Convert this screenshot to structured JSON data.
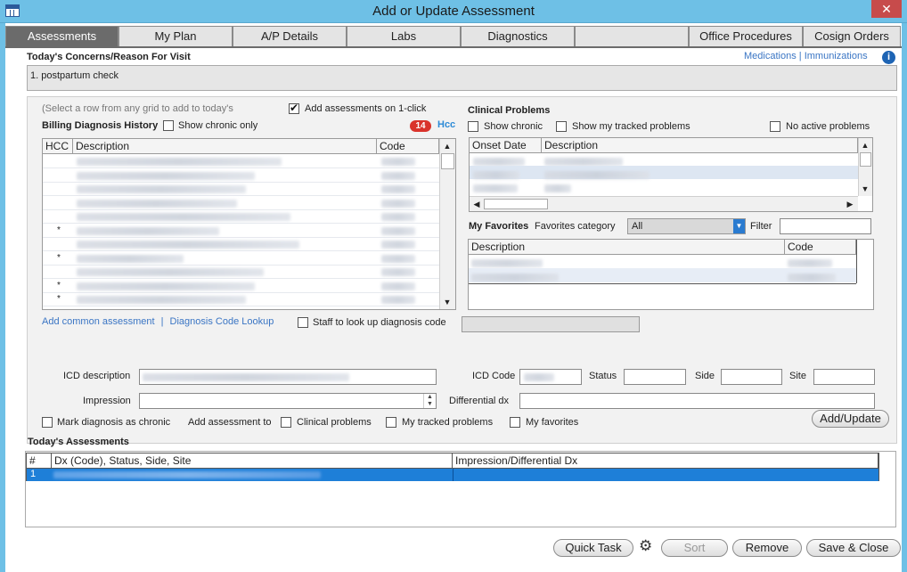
{
  "window": {
    "title": "Add or Update Assessment",
    "close": "✕"
  },
  "tabs": [
    "Assessments",
    "My Plan",
    "A/P Details",
    "Labs",
    "Diagnostics",
    "",
    "Office Procedures",
    "Cosign Orders"
  ],
  "concerns": {
    "label": "Today's Concerns/Reason For Visit",
    "value": "1. postpartum check",
    "link_meds": "Medications",
    "link_sep": "|",
    "link_imm": "Immunizations",
    "info": "i"
  },
  "billing": {
    "hint": "(Select a row from any grid to add to today's",
    "add_1click": "Add assessments on 1-click",
    "title": "Billing Diagnosis History",
    "chronic_only": "Show chronic only",
    "badge": "14",
    "hcc": "Hcc",
    "columns": [
      "HCC",
      "Description",
      "Code"
    ],
    "hcc_marks": [
      "",
      "",
      "",
      "",
      "",
      "*",
      "",
      "*",
      "",
      "*",
      "*"
    ]
  },
  "links": {
    "add_common": "Add common assessment",
    "sep": "|",
    "dx_lookup": "Diagnosis Code Lookup",
    "staff_lookup": "Staff to look up diagnosis code"
  },
  "clinical": {
    "title": "Clinical Problems",
    "show_chronic": "Show chronic",
    "tracked": "Show my tracked problems",
    "no_active": "No active problems",
    "columns": [
      "Onset Date",
      "Description"
    ]
  },
  "favorites": {
    "title": "My Favorites",
    "category_label": "Favorites category",
    "category_value": "All",
    "filter_label": "Filter",
    "columns": [
      "Description",
      "Code"
    ]
  },
  "details": {
    "icd_desc": "ICD description",
    "impression": "Impression",
    "icd_code": "ICD Code",
    "status": "Status",
    "side": "Side",
    "site": "Site",
    "diff_dx": "Differential dx"
  },
  "options": {
    "mark_chronic": "Mark diagnosis as chronic",
    "add_to": "Add assessment to",
    "clinical": "Clinical problems",
    "tracked": "My tracked problems",
    "favorites": "My favorites",
    "add_update": "Add/Update"
  },
  "today": {
    "title": "Today's Assessments",
    "columns": [
      "#",
      "Dx (Code), Status, Side, Site",
      "Impression/Differential Dx"
    ],
    "rows": [
      {
        "num": "1"
      }
    ]
  },
  "footer": {
    "quick_task": "Quick Task",
    "gear": "⚙",
    "sort": "Sort",
    "remove": "Remove",
    "save_close": "Save & Close"
  },
  "colors": {
    "titlebar": "#6ec0e6",
    "selected_row": "#1e7fd8",
    "link": "#3a75c4",
    "badge": "#d9332b"
  }
}
